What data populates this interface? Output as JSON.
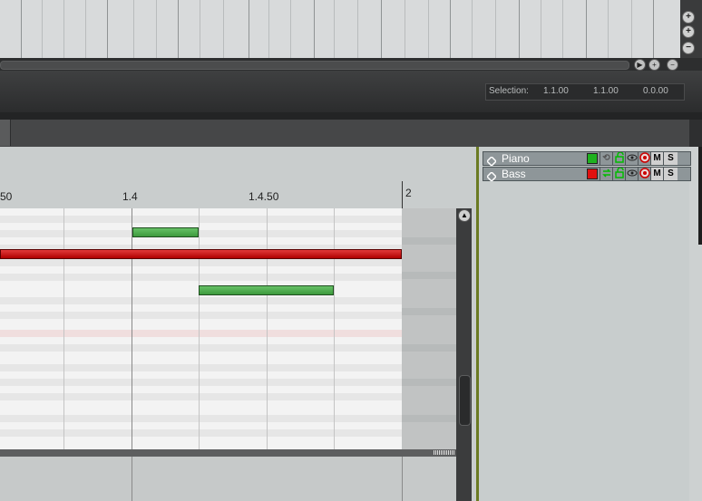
{
  "selection": {
    "label": "Selection:",
    "start": "1.1.00",
    "end": "1.1.00",
    "length": "0.0.00"
  },
  "ruler": {
    "labels": [
      "50",
      "1.4",
      "1.4.50",
      "2"
    ]
  },
  "tracks": [
    {
      "name": "Piano",
      "color": "#1fb21f",
      "mute_label": "M",
      "solo_label": "S"
    },
    {
      "name": "Bass",
      "color": "#e01010",
      "mute_label": "M",
      "solo_label": "S"
    }
  ],
  "zoom_buttons": [
    "+",
    "+",
    "−"
  ],
  "transport_buttons": [
    "▶",
    "+",
    "−"
  ],
  "scroll_up_glyph": "▲",
  "note_colors": {
    "normal": "#4aa84a",
    "selected": "#c81010"
  }
}
